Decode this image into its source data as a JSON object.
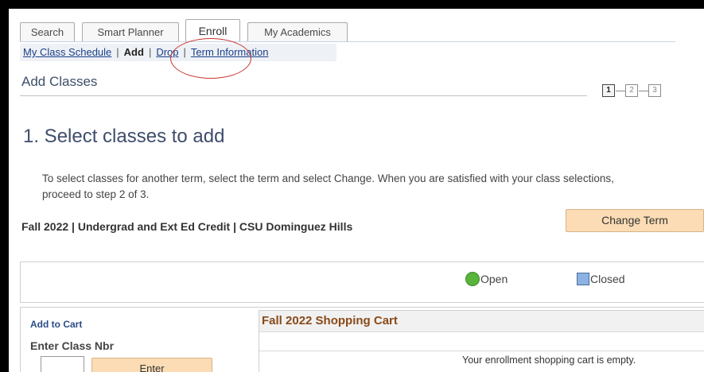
{
  "tabs": [
    {
      "label": "Search",
      "active": false
    },
    {
      "label": "Smart Planner",
      "active": false
    },
    {
      "label": "Enroll",
      "active": true
    },
    {
      "label": "My Academics",
      "active": false
    }
  ],
  "subnav": {
    "my_class_schedule": "My Class Schedule",
    "add": "Add",
    "drop": "Drop",
    "term_information": "Term Information",
    "separator": "|"
  },
  "page": {
    "title": "Add Classes",
    "steps": [
      "1",
      "2",
      "3"
    ],
    "current_step": 1
  },
  "section": {
    "title": "1.  Select classes to add",
    "instructions": "To select classes for another term, select the term and select Change.  When you are satisfied with your class selections, proceed to step 2 of 3.",
    "term": "Fall 2022 | Undergrad and Ext Ed Credit | CSU Dominguez Hills",
    "change_term_label": "Change Term"
  },
  "legend": {
    "open": "Open",
    "closed": "Closed"
  },
  "add_to_cart": {
    "heading": "Add to Cart",
    "field_label": "Enter Class Nbr",
    "input_value": "",
    "enter_label": "Enter"
  },
  "cart": {
    "title": "Fall 2022 Shopping Cart",
    "empty_message": "Your enrollment shopping cart is empty."
  },
  "colors": {
    "accent_button": "#fbdcb4",
    "link": "#1a3f8a",
    "open": "#58b43b",
    "closed": "#8bb2e3",
    "annotation_circle": "#c8342d",
    "cart_title": "#8a4a18"
  }
}
